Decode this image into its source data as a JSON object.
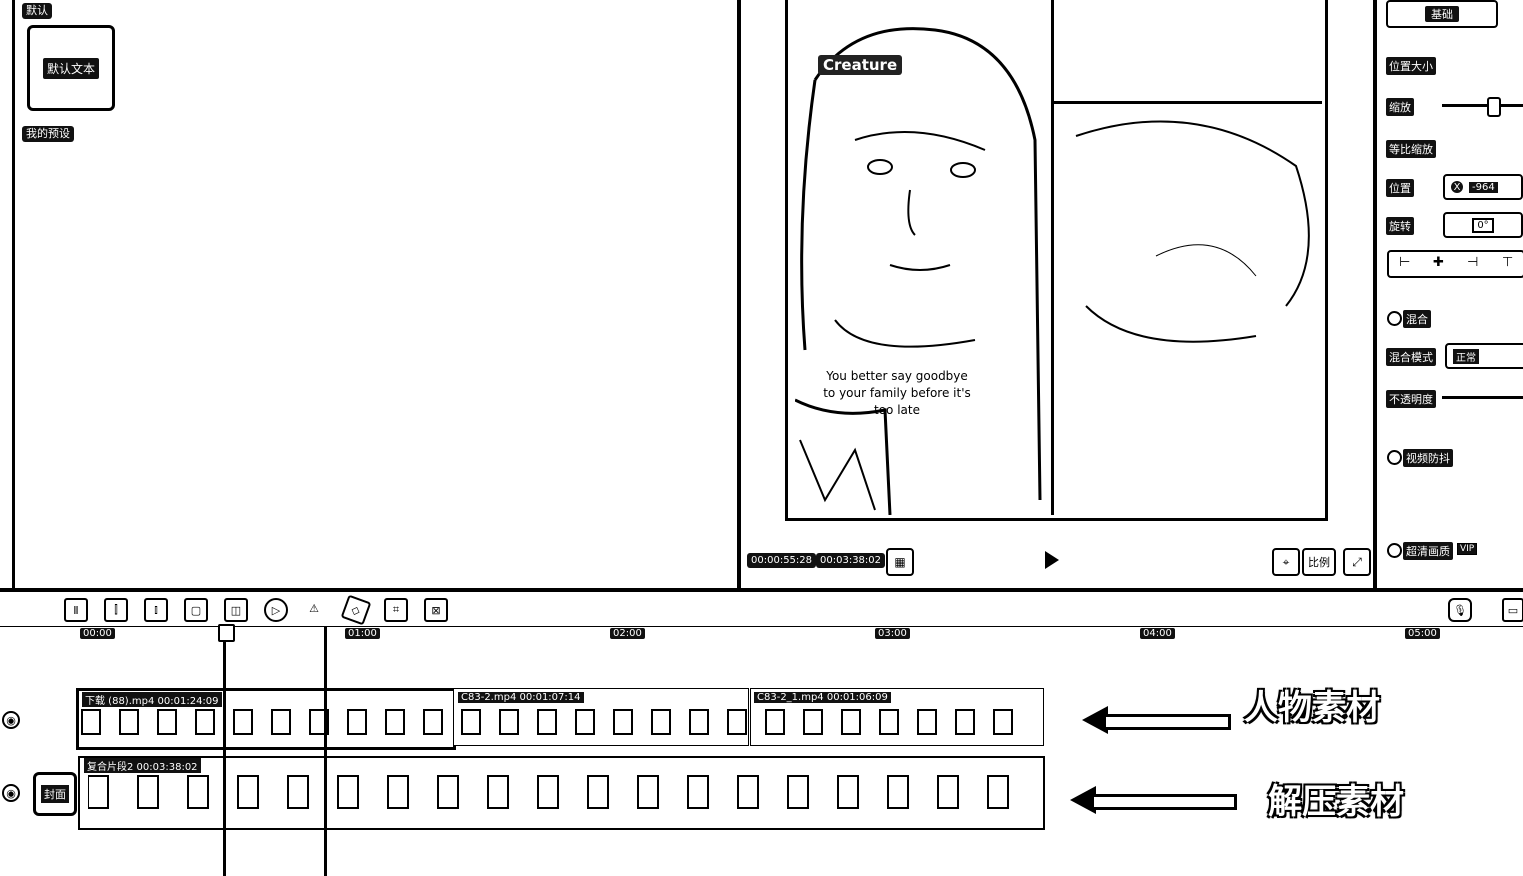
{
  "left_panel": {
    "default_label": "默认",
    "preset_text": "默认文本",
    "my_presets_label": "我的预设"
  },
  "preview": {
    "watermark": "Creature",
    "subtitle": "You better say goodbye to your family before it's too late",
    "current_time": "00:00:55:28",
    "total_time": "00:03:38:02",
    "ratio_label": "比例"
  },
  "props": {
    "tab_basic": "基础",
    "position_size": "位置大小",
    "scale": "缩放",
    "uniform_scale": "等比缩放",
    "position": "位置",
    "x_label": "X",
    "x_value": "-964",
    "rotate": "旋转",
    "rotate_value": "0°",
    "blend": "混合",
    "blend_mode_label": "混合模式",
    "blend_mode_value": "正常",
    "opacity": "不透明度",
    "stabilize": "视频防抖",
    "hd": "超清画质",
    "vip": "VIP"
  },
  "timeline": {
    "ticks": [
      "00:00",
      "01:00",
      "02:00",
      "03:00",
      "04:00",
      "05:00"
    ],
    "cover_label": "封面",
    "track1_clips": [
      {
        "title": "下载 (88).mp4  00:01:24:09"
      },
      {
        "title": "C83-2.mp4  00:01:07:14"
      },
      {
        "title": "C83-2_1.mp4  00:01:06:09"
      }
    ],
    "track2_clip": "复合片段2  00:03:38:02",
    "annotation_person": "人物素材",
    "annotation_asmr": "解压素材"
  }
}
